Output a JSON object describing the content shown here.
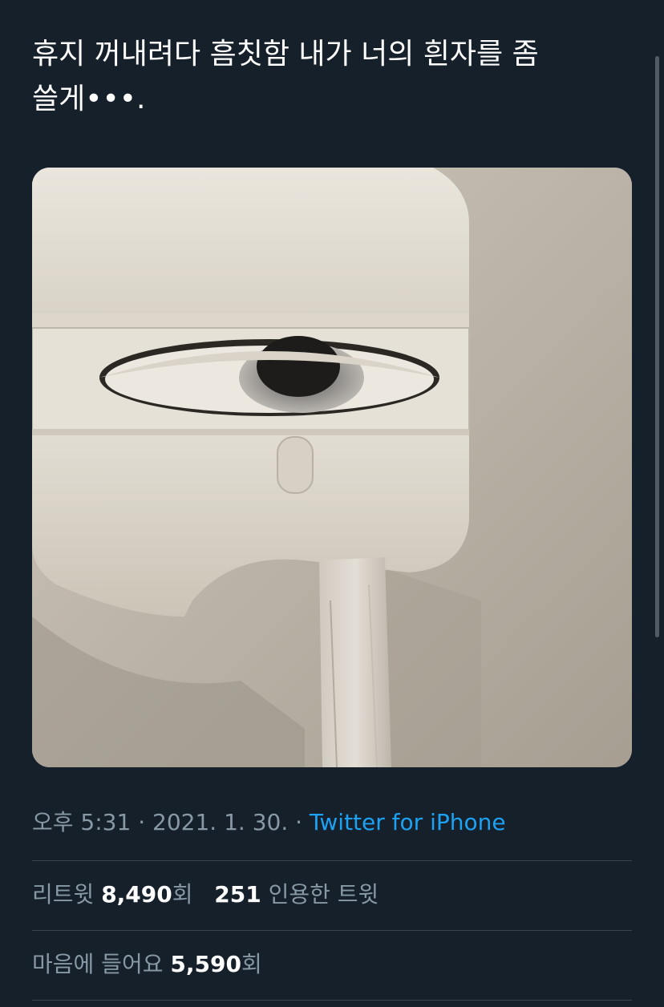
{
  "tweet": {
    "text": "휴지 꺼내려다 흠칫함 내가 너의 흰자를 좀\n쓸게•••."
  },
  "media": {
    "icon": "photo-toilet-paper-dispenser-eye"
  },
  "meta": {
    "time": "오후 5:31",
    "separator1": " · ",
    "date": "2021. 1. 30.",
    "separator2": " · ",
    "source": "Twitter for iPhone"
  },
  "stats": {
    "retweets_label": "리트윗",
    "retweets_count": "8,490",
    "retweets_unit": "회",
    "quotes_count": "251",
    "quotes_label": "인용한 트윗",
    "likes_label": "마음에 들어요",
    "likes_count": "5,590",
    "likes_unit": "회"
  },
  "colors": {
    "background": "#15202b",
    "accent": "#1da1f2",
    "secondary_text": "#8899a6",
    "divider": "#38444d"
  }
}
